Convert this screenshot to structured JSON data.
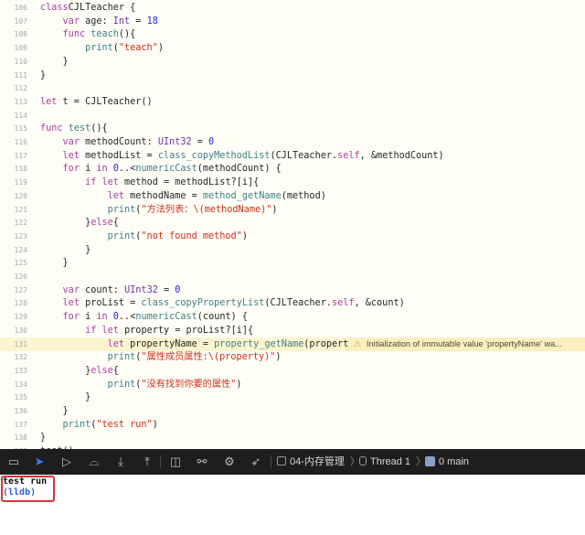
{
  "editor": {
    "lines": [
      {
        "n": "106",
        "tokens": [
          [
            "kw",
            "class"
          ],
          [
            "",
            "CJLTeacher {"
          ]
        ]
      },
      {
        "n": "107",
        "tokens": [
          [
            "",
            "    "
          ],
          [
            "kw",
            "var"
          ],
          [
            "",
            " age: "
          ],
          [
            "ty",
            "Int"
          ],
          [
            "",
            " = "
          ],
          [
            "nm",
            "18"
          ]
        ]
      },
      {
        "n": "108",
        "tokens": [
          [
            "",
            "    "
          ],
          [
            "kw",
            "func"
          ],
          [
            "",
            " "
          ],
          [
            "fn",
            "teach"
          ],
          [
            "",
            "(){"
          ]
        ]
      },
      {
        "n": "109",
        "tokens": [
          [
            "",
            "        "
          ],
          [
            "fn",
            "print"
          ],
          [
            "",
            "("
          ],
          [
            "st",
            "\"teach\""
          ],
          [
            "",
            ")"
          ]
        ]
      },
      {
        "n": "110",
        "tokens": [
          [
            "",
            "    }"
          ]
        ]
      },
      {
        "n": "111",
        "tokens": [
          [
            "",
            "}"
          ]
        ]
      },
      {
        "n": "112",
        "tokens": []
      },
      {
        "n": "113",
        "tokens": [
          [
            "kw",
            "let"
          ],
          [
            "",
            " t = CJLTeacher()"
          ]
        ]
      },
      {
        "n": "114",
        "tokens": []
      },
      {
        "n": "115",
        "tokens": [
          [
            "kw",
            "func"
          ],
          [
            "",
            " "
          ],
          [
            "fn",
            "test"
          ],
          [
            "",
            "(){"
          ]
        ]
      },
      {
        "n": "116",
        "tokens": [
          [
            "",
            "    "
          ],
          [
            "kw",
            "var"
          ],
          [
            "",
            " methodCount: "
          ],
          [
            "ty",
            "UInt32"
          ],
          [
            "",
            " = "
          ],
          [
            "nm",
            "0"
          ]
        ]
      },
      {
        "n": "117",
        "tokens": [
          [
            "",
            "    "
          ],
          [
            "kw",
            "let"
          ],
          [
            "",
            " methodList = "
          ],
          [
            "fn",
            "class_copyMethodList"
          ],
          [
            "",
            "(CJLTeacher."
          ],
          [
            "kw",
            "self"
          ],
          [
            "",
            ", &methodCount)"
          ]
        ]
      },
      {
        "n": "118",
        "tokens": [
          [
            "",
            "    "
          ],
          [
            "kw",
            "for"
          ],
          [
            "",
            " i "
          ],
          [
            "kw",
            "in"
          ],
          [
            "",
            " "
          ],
          [
            "nm",
            "0"
          ],
          [
            "",
            "..<"
          ],
          [
            "fn",
            "numericCast"
          ],
          [
            "",
            "(methodCount) {"
          ]
        ]
      },
      {
        "n": "119",
        "tokens": [
          [
            "",
            "        "
          ],
          [
            "kw",
            "if"
          ],
          [
            "",
            " "
          ],
          [
            "kw",
            "let"
          ],
          [
            "",
            " method = methodList?[i]{"
          ]
        ]
      },
      {
        "n": "120",
        "tokens": [
          [
            "",
            "            "
          ],
          [
            "kw",
            "let"
          ],
          [
            "",
            " methodName = "
          ],
          [
            "fn",
            "method_getName"
          ],
          [
            "",
            "(method)"
          ]
        ]
      },
      {
        "n": "121",
        "tokens": [
          [
            "",
            "            "
          ],
          [
            "fn",
            "print"
          ],
          [
            "",
            "("
          ],
          [
            "st",
            "\"方法列表：\\(methodName)\""
          ],
          [
            "",
            ")"
          ]
        ]
      },
      {
        "n": "122",
        "tokens": [
          [
            "",
            "        }"
          ],
          [
            "kw",
            "else"
          ],
          [
            "",
            "{"
          ]
        ]
      },
      {
        "n": "123",
        "tokens": [
          [
            "",
            "            "
          ],
          [
            "fn",
            "print"
          ],
          [
            "",
            "("
          ],
          [
            "st",
            "\"not found method\""
          ],
          [
            "",
            ")"
          ]
        ]
      },
      {
        "n": "124",
        "tokens": [
          [
            "",
            "        }"
          ]
        ]
      },
      {
        "n": "125",
        "tokens": [
          [
            "",
            "    }"
          ]
        ]
      },
      {
        "n": "126",
        "tokens": []
      },
      {
        "n": "127",
        "tokens": [
          [
            "",
            "    "
          ],
          [
            "kw",
            "var"
          ],
          [
            "",
            " count: "
          ],
          [
            "ty",
            "UInt32"
          ],
          [
            "",
            " = "
          ],
          [
            "nm",
            "0"
          ]
        ]
      },
      {
        "n": "128",
        "tokens": [
          [
            "",
            "    "
          ],
          [
            "kw",
            "let"
          ],
          [
            "",
            " proList = "
          ],
          [
            "fn",
            "class_copyPropertyList"
          ],
          [
            "",
            "(CJLTeacher."
          ],
          [
            "kw",
            "self"
          ],
          [
            "",
            ", &count)"
          ]
        ]
      },
      {
        "n": "129",
        "tokens": [
          [
            "",
            "    "
          ],
          [
            "kw",
            "for"
          ],
          [
            "",
            " i "
          ],
          [
            "kw",
            "in"
          ],
          [
            "",
            " "
          ],
          [
            "nm",
            "0"
          ],
          [
            "",
            "..<"
          ],
          [
            "fn",
            "numericCast"
          ],
          [
            "",
            "(count) {"
          ]
        ]
      },
      {
        "n": "130",
        "tokens": [
          [
            "",
            "        "
          ],
          [
            "kw",
            "if"
          ],
          [
            "",
            " "
          ],
          [
            "kw",
            "let"
          ],
          [
            "",
            " property = proList?[i]{"
          ]
        ]
      },
      {
        "n": "131",
        "tokens": [
          [
            "",
            "            "
          ],
          [
            "kw",
            "let"
          ],
          [
            "",
            " propertyName = "
          ],
          [
            "fn",
            "property_getName"
          ],
          [
            "",
            "(property)"
          ]
        ],
        "highlight": true
      },
      {
        "n": "132",
        "tokens": [
          [
            "",
            "            "
          ],
          [
            "fn",
            "print"
          ],
          [
            "",
            "("
          ],
          [
            "st",
            "\"属性成员属性:\\(property)\""
          ],
          [
            "",
            ")"
          ]
        ]
      },
      {
        "n": "133",
        "tokens": [
          [
            "",
            "        }"
          ],
          [
            "kw",
            "else"
          ],
          [
            "",
            "{"
          ]
        ]
      },
      {
        "n": "134",
        "tokens": [
          [
            "",
            "            "
          ],
          [
            "fn",
            "print"
          ],
          [
            "",
            "("
          ],
          [
            "st",
            "\"没有找到你要的属性\""
          ],
          [
            "",
            ")"
          ]
        ]
      },
      {
        "n": "135",
        "tokens": [
          [
            "",
            "        }"
          ]
        ]
      },
      {
        "n": "136",
        "tokens": [
          [
            "",
            "    }"
          ]
        ]
      },
      {
        "n": "137",
        "tokens": [
          [
            "",
            "    "
          ],
          [
            "fn",
            "print"
          ],
          [
            "",
            "("
          ],
          [
            "st",
            "\"test run\""
          ],
          [
            "",
            ")"
          ]
        ]
      },
      {
        "n": "138",
        "tokens": [
          [
            "",
            "}"
          ]
        ]
      },
      {
        "n": "139",
        "tokens": [
          [
            "",
            "test()"
          ]
        ]
      }
    ],
    "warning": {
      "icon": "warning-icon",
      "text": "Initialization of immutable value 'propertyName' wa..."
    }
  },
  "debugbar": {
    "icons": [
      {
        "name": "hide-debug-area-icon",
        "glyph": "▭"
      },
      {
        "name": "breakpoints-toggle-icon",
        "glyph": "➤"
      },
      {
        "name": "continue-icon",
        "glyph": "▷"
      },
      {
        "name": "step-over-icon",
        "glyph": "⌓"
      },
      {
        "name": "step-into-icon",
        "glyph": "⤓"
      },
      {
        "name": "step-out-icon",
        "glyph": "⤒"
      },
      {
        "name": "view-hierarchy-icon",
        "glyph": "◫"
      },
      {
        "name": "memory-graph-icon",
        "glyph": "⚯"
      },
      {
        "name": "environment-overrides-icon",
        "glyph": "⚙"
      },
      {
        "name": "simulate-location-icon",
        "glyph": "➶"
      }
    ],
    "breadcrumbs": {
      "project": "04-内存管理",
      "thread": "Thread 1",
      "frame": "0 main"
    },
    "colors": {
      "active": "#3a7cf6",
      "background": "#1e1e1e"
    }
  },
  "console": {
    "output": "test run",
    "prompt": "(lldb)",
    "highlight_color": "#d9343a"
  }
}
